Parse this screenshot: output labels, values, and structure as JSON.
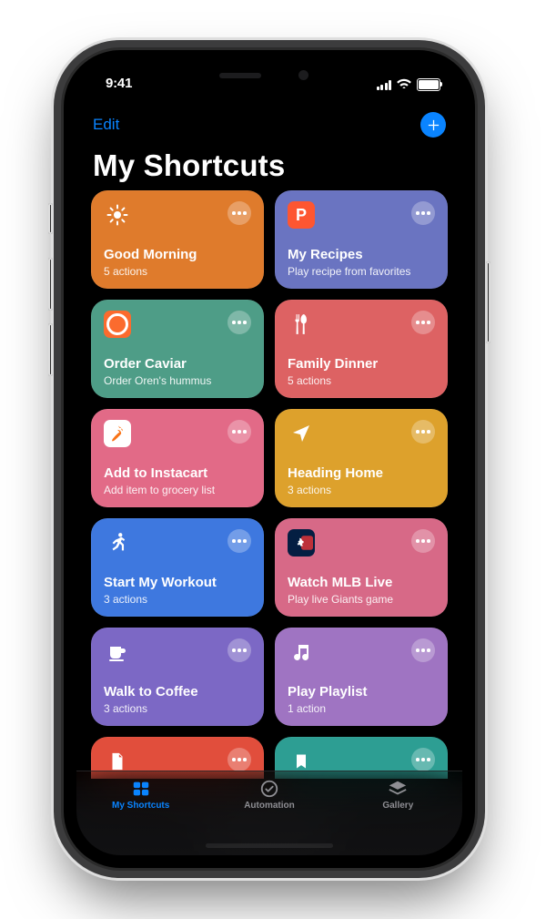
{
  "status": {
    "time": "9:41"
  },
  "nav": {
    "edit": "Edit"
  },
  "title": "My Shortcuts",
  "colors": {
    "orange": "#DF7B2C",
    "indigo": "#6A74C1",
    "teal": "#4E9D87",
    "coral": "#DD6263",
    "pink": "#E26A87",
    "gold": "#DDA12C",
    "blue": "#3E78DF",
    "rose": "#D76987",
    "violet": "#7C68C5",
    "purple": "#9F74C2",
    "red": "#E14E3C",
    "teal2": "#2D9E93"
  },
  "shortcuts": [
    {
      "title": "Good Morning",
      "subtitle": "5 actions",
      "bg": "orange",
      "icon": "sun",
      "iconType": "glyph"
    },
    {
      "title": "My Recipes",
      "subtitle": "Play recipe from favorites",
      "bg": "indigo",
      "icon": "P",
      "iconType": "app",
      "appBg": "#fd5631"
    },
    {
      "title": "Order Caviar",
      "subtitle": "Order Oren's hummus",
      "bg": "teal",
      "icon": "C",
      "iconType": "app",
      "appBg": "#fb6b2e"
    },
    {
      "title": "Family Dinner",
      "subtitle": "5 actions",
      "bg": "coral",
      "icon": "knife-fork",
      "iconType": "glyph"
    },
    {
      "title": "Add to Instacart",
      "subtitle": "Add item to grocery list",
      "bg": "pink",
      "icon": "carrot",
      "iconType": "app",
      "appBg": "#ffffff"
    },
    {
      "title": "Heading Home",
      "subtitle": "3 actions",
      "bg": "gold",
      "icon": "nav-arrow",
      "iconType": "glyph"
    },
    {
      "title": "Start My Workout",
      "subtitle": "3 actions",
      "bg": "blue",
      "icon": "runner",
      "iconType": "glyph"
    },
    {
      "title": "Watch MLB Live",
      "subtitle": "Play live Giants game",
      "bg": "rose",
      "icon": "mlb",
      "iconType": "app",
      "appBg": "#041e42"
    },
    {
      "title": "Walk to Coffee",
      "subtitle": "3 actions",
      "bg": "violet",
      "icon": "mug",
      "iconType": "glyph"
    },
    {
      "title": "Play Playlist",
      "subtitle": "1 action",
      "bg": "purple",
      "icon": "music",
      "iconType": "glyph"
    },
    {
      "title": "",
      "subtitle": "",
      "bg": "red",
      "icon": "doc",
      "iconType": "glyph"
    },
    {
      "title": "",
      "subtitle": "",
      "bg": "teal2",
      "icon": "bookmark",
      "iconType": "glyph"
    }
  ],
  "tabs": [
    {
      "label": "My Shortcuts",
      "icon": "tiles",
      "active": true
    },
    {
      "label": "Automation",
      "icon": "check-circle",
      "active": false
    },
    {
      "label": "Gallery",
      "icon": "stack",
      "active": false
    }
  ]
}
